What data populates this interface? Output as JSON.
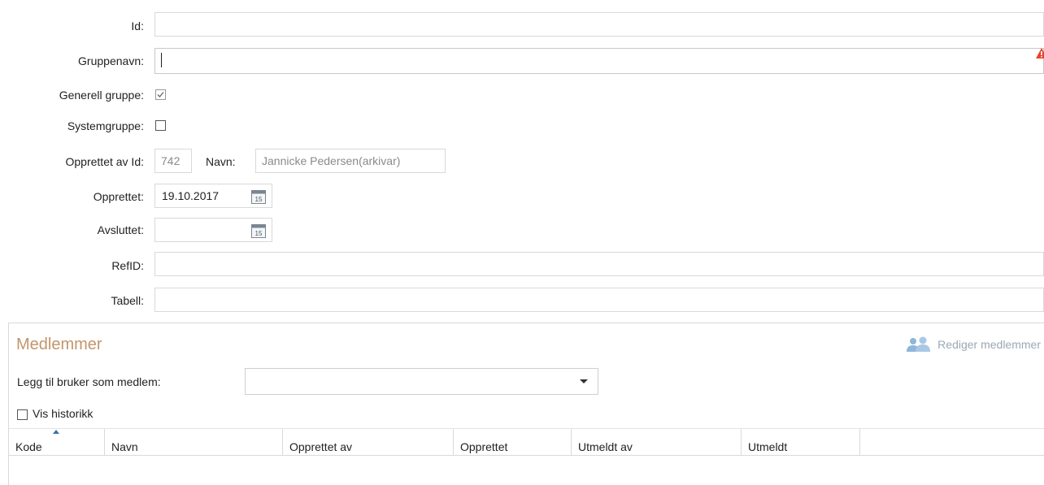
{
  "form": {
    "id": {
      "label": "Id:",
      "value": ""
    },
    "group_name": {
      "label": "Gruppenavn:",
      "value": ""
    },
    "general_group": {
      "label": "Generell gruppe:",
      "checked": true
    },
    "system_group": {
      "label": "Systemgruppe:",
      "checked": false
    },
    "created_by": {
      "label": "Opprettet av Id:",
      "id_value": "742",
      "name_label": "Navn:",
      "name_value": "Jannicke Pedersen(arkivar)"
    },
    "created": {
      "label": "Opprettet:",
      "value": "19.10.2017"
    },
    "ended": {
      "label": "Avsluttet:",
      "value": ""
    },
    "ref_id": {
      "label": "RefID:",
      "value": ""
    },
    "table": {
      "label": "Tabell:",
      "value": ""
    }
  },
  "icons": {
    "calendar_day": "15",
    "warning_color": "#e8412e"
  },
  "members": {
    "title": "Medlemmer",
    "edit_button": "Rediger medlemmer",
    "add_label": "Legg til bruker som medlem:",
    "add_value": "",
    "history_label": "Vis historikk",
    "history_checked": false,
    "columns": [
      "Kode",
      "Navn",
      "Opprettet av",
      "Opprettet",
      "Utmeldt av",
      "Utmeldt"
    ]
  },
  "colors": {
    "accent": "#c3956b",
    "disabled_text": "#8a8a8a"
  }
}
